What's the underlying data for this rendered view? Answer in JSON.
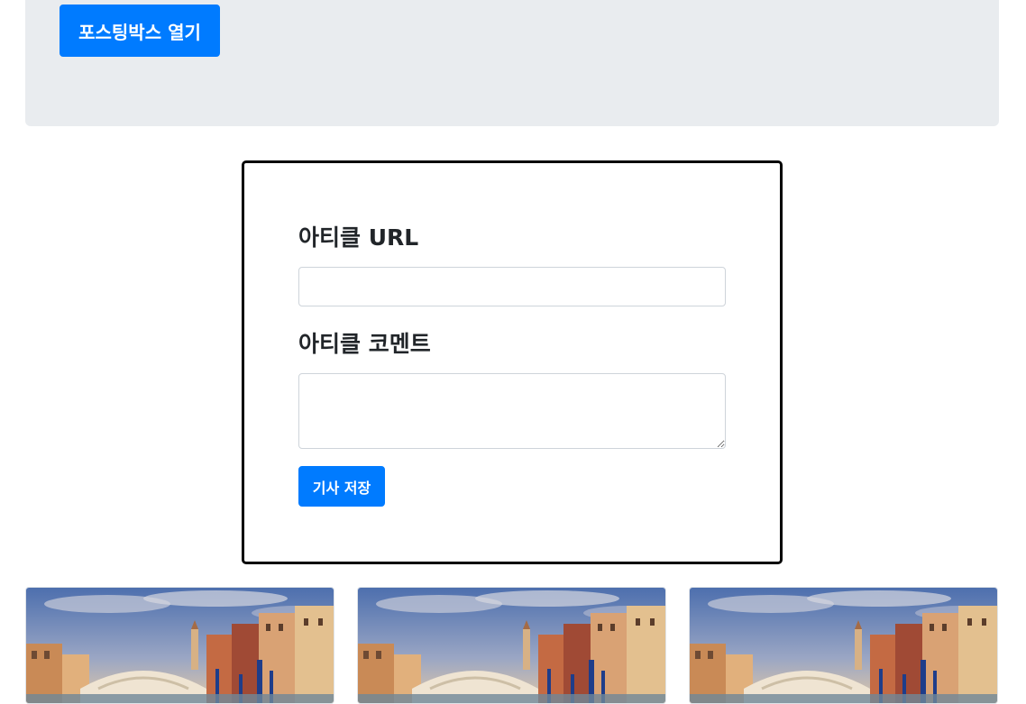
{
  "jumbotron": {
    "open_button_label": "포스팅박스 열기"
  },
  "posting_box": {
    "url_label": "아티클 URL",
    "url_value": "",
    "comment_label": "아티클 코멘트",
    "comment_value": "",
    "save_button_label": "기사 저장"
  },
  "cards": [
    {
      "image": "venice-rialto-bridge-photo"
    },
    {
      "image": "venice-rialto-bridge-photo"
    },
    {
      "image": "venice-rialto-bridge-photo"
    }
  ],
  "colors": {
    "primary": "#007bff",
    "jumbotron_bg": "#e9ecef",
    "box_border": "#000000"
  }
}
